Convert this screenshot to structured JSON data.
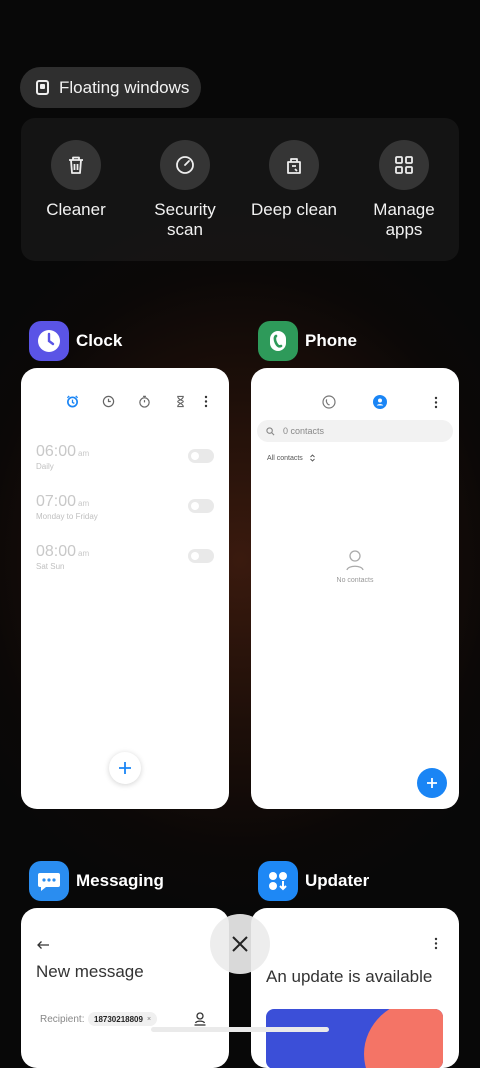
{
  "floating_windows": {
    "label": "Floating windows"
  },
  "tools": [
    {
      "label": "Cleaner",
      "icon": "trash-icon"
    },
    {
      "label": "Security\nscan",
      "icon": "security-scan-icon"
    },
    {
      "label": "Deep clean",
      "icon": "deep-clean-icon"
    },
    {
      "label": "Manage\napps",
      "icon": "grid-apps-icon"
    }
  ],
  "apps": {
    "clock": {
      "name": "Clock",
      "alarms": [
        {
          "time": "06:00",
          "ampm": "am",
          "repeat": "Daily"
        },
        {
          "time": "07:00",
          "ampm": "am",
          "repeat": "Monday to Friday"
        },
        {
          "time": "08:00",
          "ampm": "am",
          "repeat": "Sat Sun"
        }
      ]
    },
    "phone": {
      "name": "Phone",
      "search_placeholder": "0 contacts",
      "filter": "All contacts",
      "empty_text": "No contacts"
    },
    "messaging": {
      "name": "Messaging",
      "title": "New message",
      "recipient_label": "Recipient:",
      "recipient_chip": "18730218809"
    },
    "updater": {
      "name": "Updater",
      "title": "An update is available"
    }
  },
  "colors": {
    "clock_icon": "#5a54e6",
    "phone_icon": "#2e9a5a",
    "messaging_icon": "#2a8df0",
    "updater_icon": "#1e88f5",
    "accent_blue": "#1a85f5"
  }
}
